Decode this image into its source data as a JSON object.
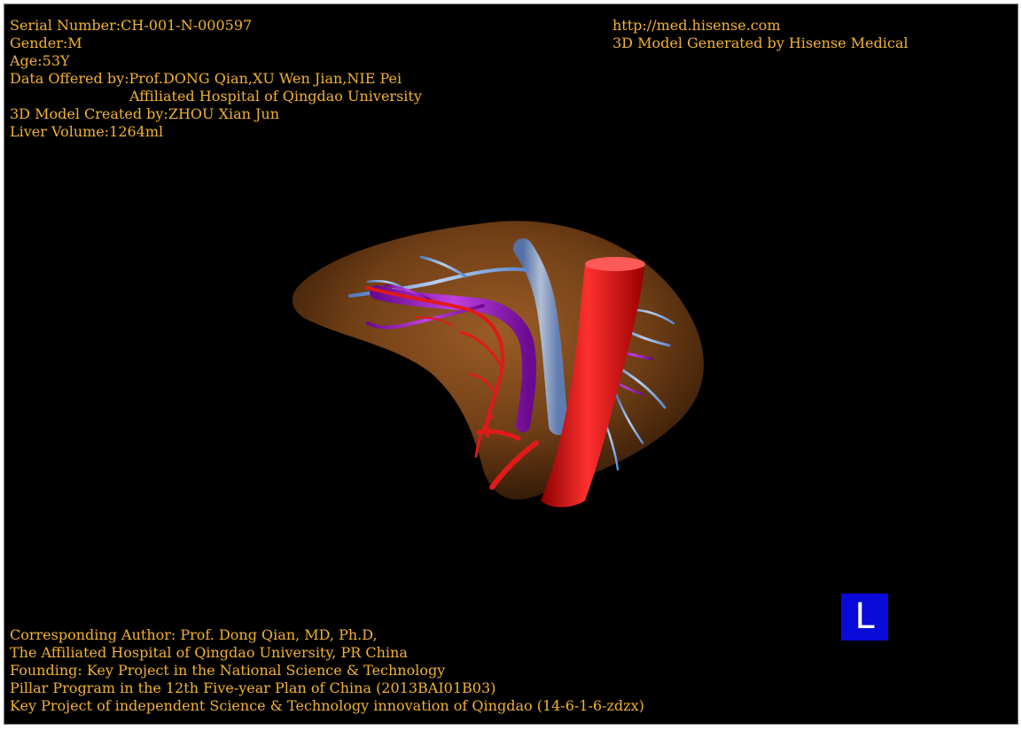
{
  "header_left": {
    "serial": "Serial Number:CH-001-N-000597",
    "gender": "Gender:M",
    "age": "Age:53Y",
    "data_offered": "Data Offered by:Prof.DONG Qian,XU Wen Jian,NIE Pei",
    "hospital": "Affiliated Hospital of Qingdao University",
    "created_by": "3D Model Created by:ZHOU Xian Jun",
    "liver_volume": "Liver Volume:1264ml"
  },
  "header_right": {
    "url": "http://med.hisense.com",
    "generated_by": "3D Model Generated by Hisense Medical"
  },
  "footer": {
    "line1": "Corresponding Author: Prof. Dong Qian, MD, Ph.D,",
    "line2": "The Affiliated Hospital of Qingdao University, PR China",
    "line3": "Founding: Key Project in the National Science & Technology",
    "line4": "Pillar Program in the 12th Five-year Plan of China (2013BAI01B03)",
    "line5": "Key Project of independent Science & Technology innovation of Qingdao (14-6-1-6-zdzx)"
  },
  "orientation_badge": {
    "label": "L"
  },
  "colors": {
    "text": "#f2b233",
    "background": "#000000",
    "badge": "#0a0ad9",
    "liver": "#8a4f1e",
    "artery": "#e01a1a",
    "portal_vein": "#9b1fc0",
    "hepatic_vein": "#6f98d6"
  }
}
